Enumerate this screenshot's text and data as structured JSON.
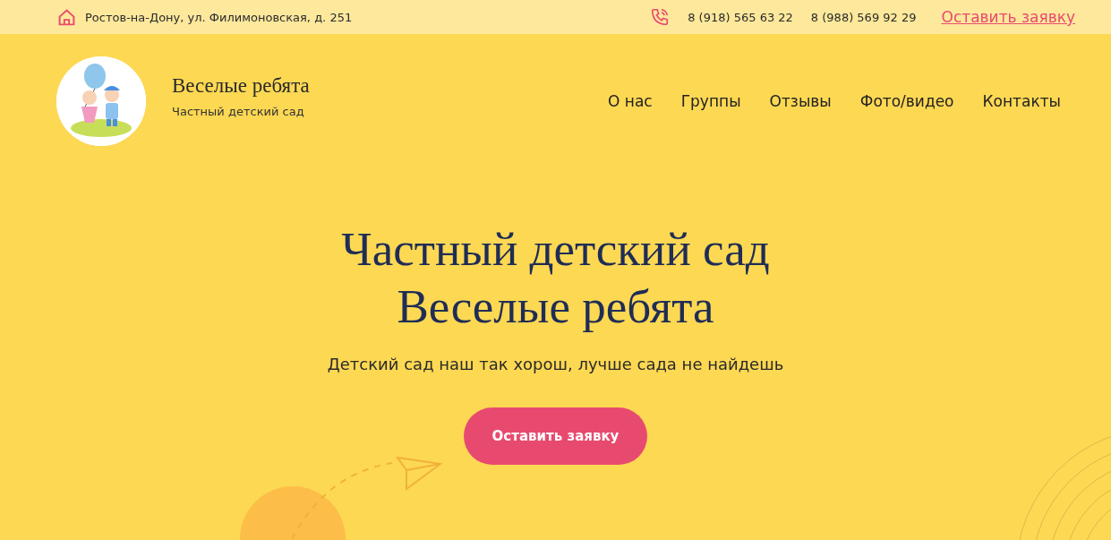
{
  "top_bar": {
    "address": "Ростов-на-Дону, ул. Филимоновская, д. 251",
    "phones": [
      "8 (918) 565 63 22",
      "8 (988) 569 92 29"
    ],
    "request_link": "Оставить заявку"
  },
  "header": {
    "site_name": "Веселые ребята",
    "tagline": "Частный детский сад",
    "nav": [
      {
        "label": "О нас"
      },
      {
        "label": "Группы"
      },
      {
        "label": "Отзывы"
      },
      {
        "label": "Фото/видео"
      },
      {
        "label": "Контакты"
      }
    ]
  },
  "hero": {
    "title_lines": [
      "Частный детский сад",
      "Веселые ребята"
    ],
    "subtitle": "Детский сад наш так хорош, лучше сада не найдешь",
    "button": "Оставить заявку"
  }
}
